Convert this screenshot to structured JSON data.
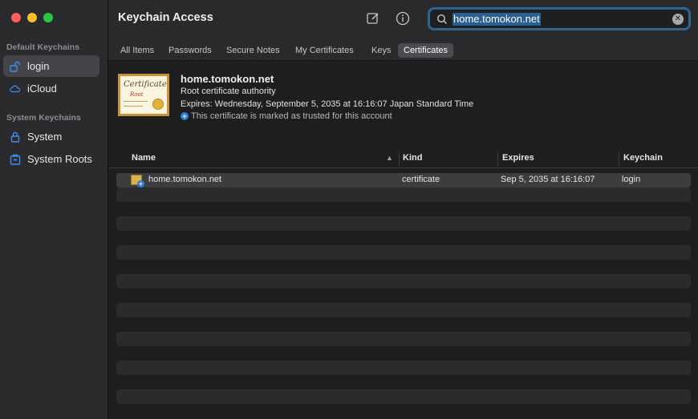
{
  "sidebar": {
    "sections": [
      {
        "title": "Default Keychains",
        "items": [
          {
            "label": "login",
            "icon": "lock-open-icon",
            "selected": true
          },
          {
            "label": "iCloud",
            "icon": "cloud-icon",
            "selected": false
          }
        ]
      },
      {
        "title": "System Keychains",
        "items": [
          {
            "label": "System",
            "icon": "lock-icon",
            "selected": false
          },
          {
            "label": "System Roots",
            "icon": "cabinet-icon",
            "selected": false
          }
        ]
      }
    ]
  },
  "titlebar": {
    "title": "Keychain Access",
    "search_value": "home.tomokon.net"
  },
  "tabs": [
    {
      "label": "All Items",
      "active": false
    },
    {
      "label": "Passwords",
      "active": false
    },
    {
      "label": "Secure Notes",
      "active": false
    },
    {
      "label": "My Certificates",
      "active": false
    },
    {
      "label": "Keys",
      "active": false
    },
    {
      "label": "Certificates",
      "active": true
    }
  ],
  "detail": {
    "cert_image_title": "Certificate",
    "cert_image_sub": "Root",
    "name": "home.tomokon.net",
    "subtitle": "Root certificate authority",
    "expires": "Expires: Wednesday, September 5, 2035 at 16:16:07 Japan Standard Time",
    "trust": "This certificate is marked as trusted for this account"
  },
  "table": {
    "columns": [
      "Name",
      "Kind",
      "Expires",
      "Keychain"
    ],
    "rows": [
      {
        "name": "home.tomokon.net",
        "kind": "certificate",
        "expires": "Sep 5, 2035 at 16:16:07",
        "keychain": "login"
      }
    ]
  },
  "colors": {
    "accent": "#2f6592",
    "selected_row": "#3d3d40",
    "trust_badge": "#2f7fd6"
  }
}
